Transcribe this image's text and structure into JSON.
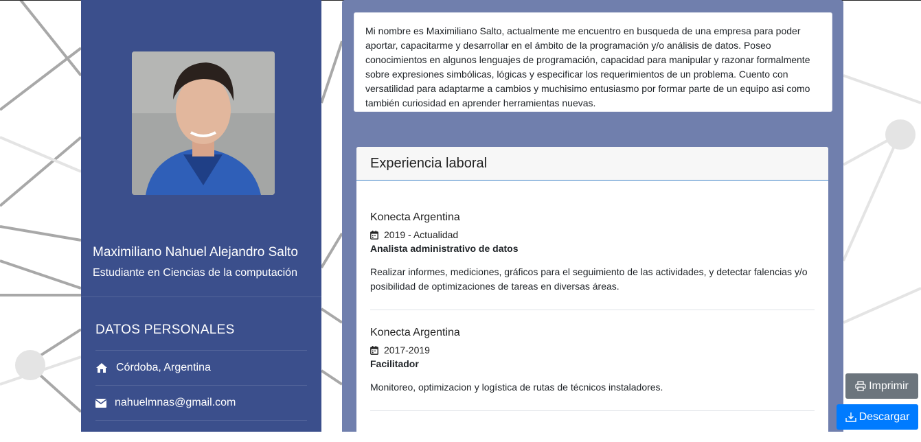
{
  "sidebar": {
    "photo_alt": "Foto de perfil",
    "name": "Maximiliano Nahuel Alejandro Salto",
    "subtitle": "Estudiante en Ciencias de la computación",
    "section_title": "DATOS PERSONALES",
    "location": "Córdoba, Argentina",
    "email": "nahuelmnas@gmail.com"
  },
  "about": {
    "text": "Mi nombre es Maximiliano Salto, actualmente me encuentro en busqueda de una empresa para poder aportar, capacitarme y desarrollar en el ámbito de la programación y/o análisis de datos. Poseo conocimientos en algunos lenguajes de programación, capacidad para manipular y razonar formalmente sobre expresiones simbólicas, lógicas y especificar los requerimientos de un problema. Cuento con versatilidad para adaptarme a cambios y muchisimo entusiasmo por formar parte de un equipo asi como también curiosidad en aprender herramientas nuevas."
  },
  "experience": {
    "title": "Experiencia laboral",
    "jobs": [
      {
        "company": "Konecta Argentina",
        "period": "2019 - Actualidad",
        "role": "Analista administrativo de datos",
        "description": "Realizar informes, mediciones, gráficos para el seguimiento de las actividades, y detectar falencias y/o posibilidad de optimizaciones de tareas en diversas áreas."
      },
      {
        "company": "Konecta Argentina",
        "period": "2017-2019",
        "role": "Facilitador",
        "description": "Monitoreo, optimizacion y logística de rutas de técnicos instaladores."
      }
    ]
  },
  "buttons": {
    "print": "Imprimir",
    "download": "Descargar"
  },
  "colors": {
    "sidebar_bg": "#3b4f8c",
    "main_bg": "#707fad",
    "print_btn": "#6c757d",
    "download_btn": "#007bff"
  },
  "icons": {
    "location": "home-icon",
    "email": "envelope-icon",
    "period": "calendar-icon",
    "print": "printer-icon",
    "download": "download-icon"
  }
}
